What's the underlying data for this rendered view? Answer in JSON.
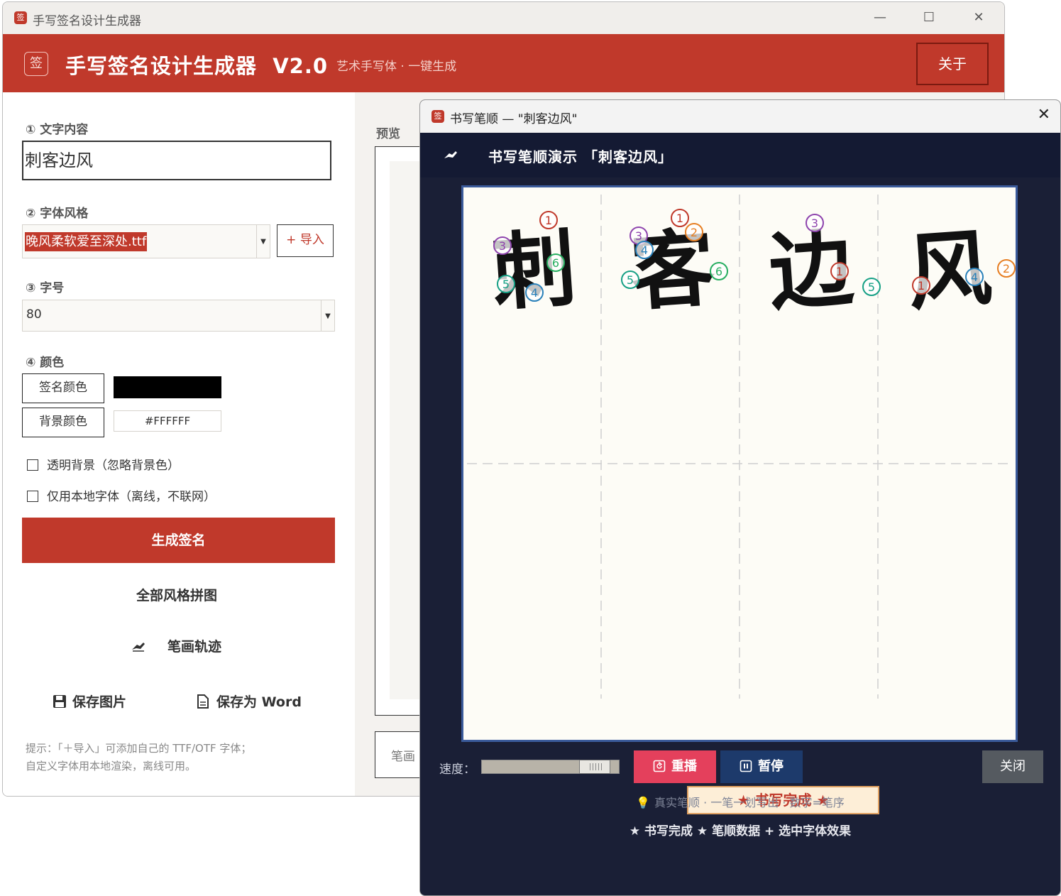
{
  "main_window": {
    "title": "手写签名设计生成器",
    "icon_glyph": "签",
    "controls": {
      "minimize": "—",
      "maximize": "☐",
      "close": "✕"
    }
  },
  "header": {
    "title": "手写签名设计生成器  V2.0",
    "subtitle": "艺术手写体 · 一键生成",
    "about_label": "关于"
  },
  "form": {
    "text_label": "① 文字内容",
    "text_value": "刺客边风",
    "font_label": "② 字体风格",
    "font_value": "晚风柔软爱至深处.ttf",
    "import_label": "+ 导入",
    "size_label": "③ 字号",
    "size_value": "80",
    "color_label": "④ 颜色",
    "sign_color_btn": "签名颜色",
    "sign_color": "#000000",
    "bg_color_btn": "背景颜色",
    "bg_color_value": "#FFFFFF",
    "transparent_bg": "透明背景（忽略背景色）",
    "local_font_only": "仅用本地字体（离线，不联网）",
    "generate_label": "生成签名",
    "all_styles_label": "全部风格拼图",
    "stroke_path_label": "笔画轨迹",
    "save_image_label": "保存图片",
    "save_word_label": "保存为 Word",
    "tip_line1": "提示：「＋导入」可添加自己的 TTF/OTF 字体；",
    "tip_line2": "自定义字体用本地渲染，离线可用。"
  },
  "preview": {
    "label": "预览",
    "stroke_label": "笔画"
  },
  "dialog": {
    "title": "书写笔顺 — \"刺客边风\"",
    "icon_glyph": "签",
    "close": "✕",
    "header_title": "书写笔顺演示 「刺客边风」",
    "characters": [
      "刺",
      "客",
      "边",
      "风"
    ],
    "stroke_markers": [
      [
        "1",
        "3",
        "6",
        "5",
        "4"
      ],
      [
        "1",
        "3",
        "2",
        "4",
        "6",
        "5"
      ],
      [
        "3",
        "1",
        "5"
      ],
      [
        "2",
        "4",
        "1"
      ]
    ],
    "done_badge": "★ 书写完成 ★",
    "speed_label": "速度：",
    "speed_value": 0.88,
    "replay_label": "重播",
    "pause_label": "暂停",
    "close_label": "关闭",
    "hint_line1": "真实笔顺 · 一笔一划写出 · 数字=笔序",
    "hint_line2": "★ 书写完成 ★  笔顺数据 + 选中字体效果"
  },
  "colors": {
    "accent_red": "#c0392b",
    "dialog_bg": "#1a1f36",
    "replay": "#e4405c",
    "pause": "#1d3a6b"
  }
}
